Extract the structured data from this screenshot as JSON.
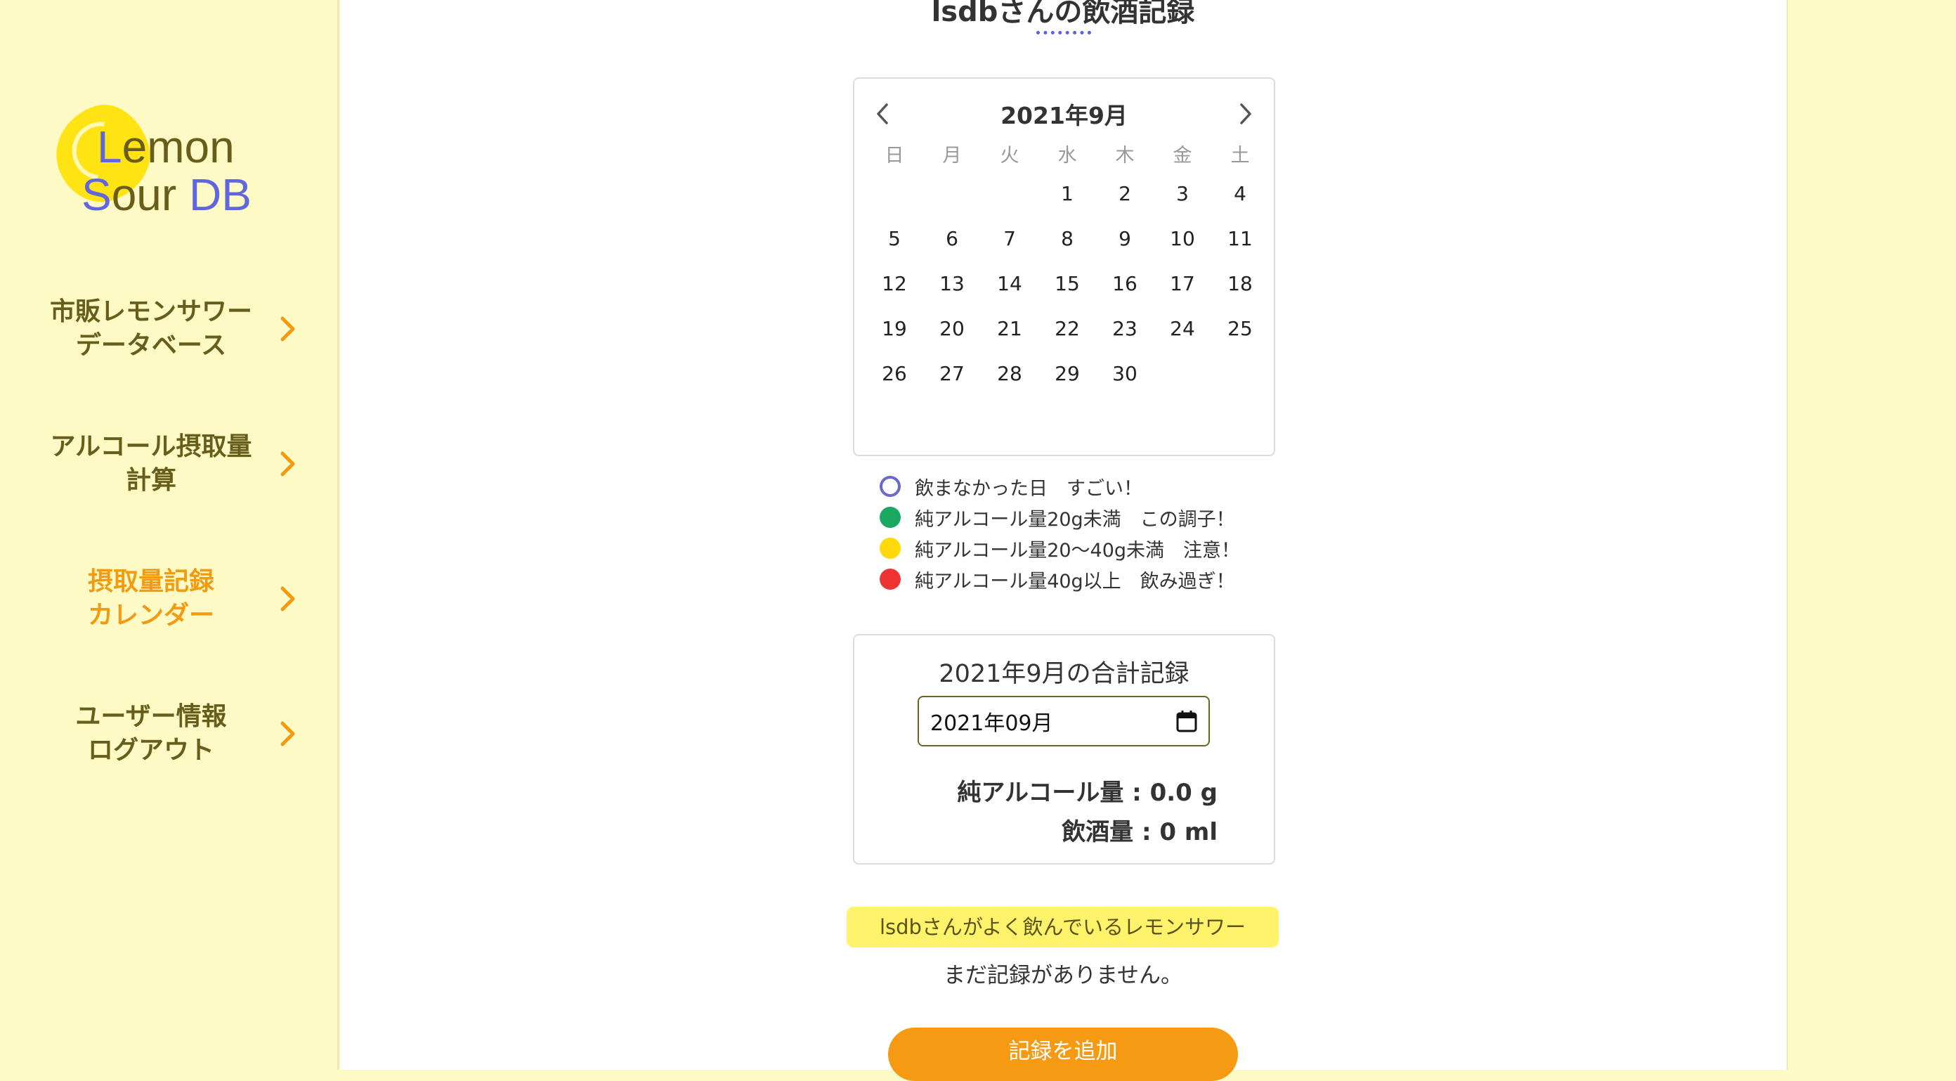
{
  "logo": {
    "part1": "L",
    "part2": "emon",
    "part3": "S",
    "part4": "our ",
    "part5": "DB"
  },
  "sidebar": {
    "items": [
      {
        "label": "市販レモンサワー\nデータベース",
        "active": false
      },
      {
        "label": "アルコール摂取量\n計算",
        "active": false
      },
      {
        "label": "摂取量記録\nカレンダー",
        "active": true
      },
      {
        "label": "ユーザー情報\nログアウト",
        "active": false
      }
    ]
  },
  "page": {
    "title": "lsdbさんの飲酒記録"
  },
  "calendar": {
    "month_title": "2021年9月",
    "weekdays": [
      "日",
      "月",
      "火",
      "水",
      "木",
      "金",
      "土"
    ],
    "weeks": [
      [
        "",
        "",
        "",
        "1",
        "2",
        "3",
        "4"
      ],
      [
        "5",
        "6",
        "7",
        "8",
        "9",
        "10",
        "11"
      ],
      [
        "12",
        "13",
        "14",
        "15",
        "16",
        "17",
        "18"
      ],
      [
        "19",
        "20",
        "21",
        "22",
        "23",
        "24",
        "25"
      ],
      [
        "26",
        "27",
        "28",
        "29",
        "30",
        "",
        ""
      ]
    ]
  },
  "legend": [
    {
      "label": "飲まなかった日　すごい！",
      "color": "#6a6ac8",
      "style": "outline"
    },
    {
      "label": "純アルコール量20g未満　この調子！",
      "color": "#1aa863",
      "style": "filled"
    },
    {
      "label": "純アルコール量20〜40g未満　注意！",
      "color": "#ffd90a",
      "style": "filled"
    },
    {
      "label": "純アルコール量40g以上　飲み過ぎ！",
      "color": "#ee3333",
      "style": "filled"
    }
  ],
  "summary": {
    "title": "2021年9月の合計記録",
    "month_value": "2021年09月",
    "alcohol": "純アルコール量 : 0.0 g",
    "volume": "飲酒量 : 0 ml"
  },
  "favorites": {
    "badge": "lsdbさんがよく飲んでいるレモンサワー",
    "empty": "まだ記録がありません。"
  },
  "actions": {
    "add_label": "記録を追加"
  },
  "colors": {
    "sidebar_bg": "#fefac5",
    "accent": "#f29a12",
    "olive": "#675e1c",
    "brand_blue": "#6065e0"
  }
}
